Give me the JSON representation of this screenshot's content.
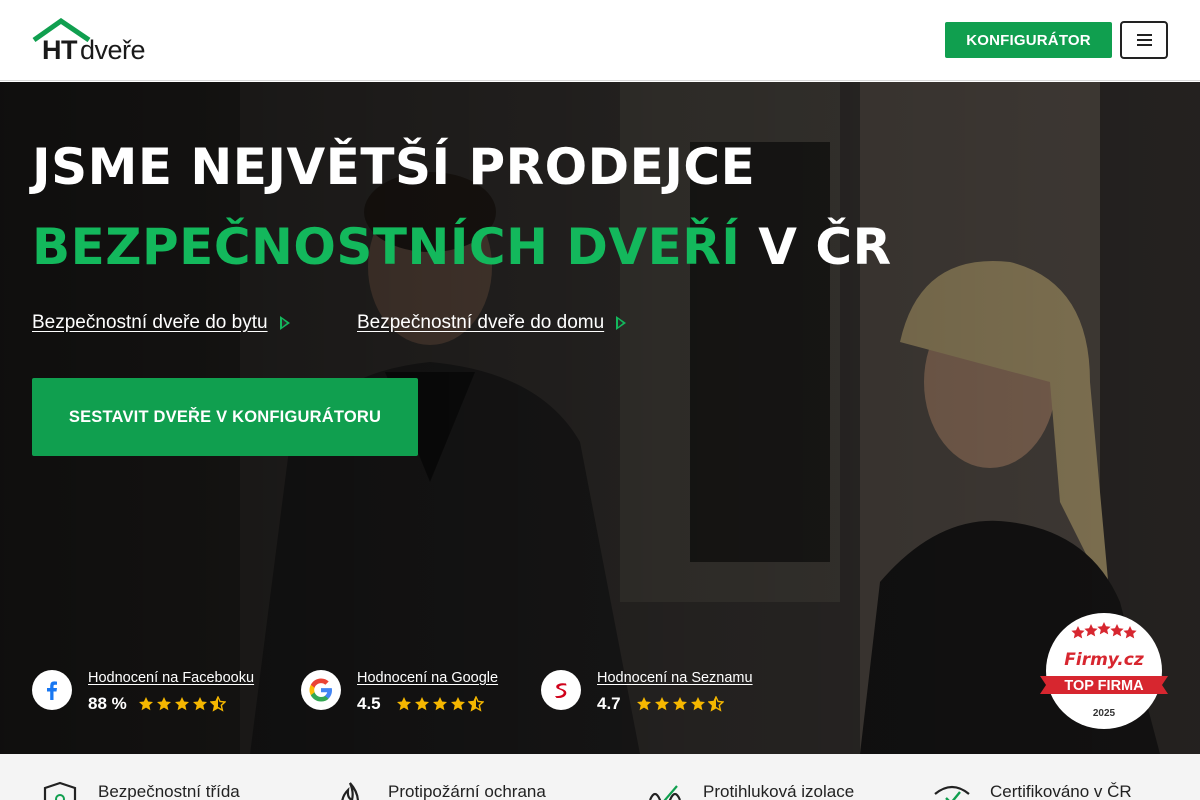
{
  "header": {
    "logo_ht": "HT",
    "logo_rest": "dveře",
    "configurator_label": "KONFIGURÁTOR"
  },
  "hero": {
    "line1": "JSME NEJVĚTŠÍ PRODEJCE",
    "line2_green": "BEZPEČNOSTNÍCH DVEŘÍ",
    "line2_rest": "V ČR",
    "links": [
      {
        "label": "Bezpečnostní dveře do bytu"
      },
      {
        "label": "Bezpečnostní dveře do domu"
      }
    ],
    "cta_label": "SESTAVIT DVEŘE V KONFIGURÁTORU"
  },
  "ratings": [
    {
      "label": "Hodnocení na Facebooku",
      "score": "88 %",
      "stars": 4.5,
      "icon": "facebook-icon"
    },
    {
      "label": "Hodnocení na Google",
      "score": "4.5",
      "stars": 4.5,
      "icon": "google-icon"
    },
    {
      "label": "Hodnocení na Seznamu",
      "score": "4.7",
      "stars": 4.5,
      "icon": "seznam-icon"
    }
  ],
  "badge": {
    "brand": "Firmy.cz",
    "title": "TOP FIRMA",
    "year": "2025"
  },
  "features": [
    {
      "label": "Bezpečnostní třída",
      "icon": "shield-icon"
    },
    {
      "label": "Protipožární ochrana",
      "icon": "flame-icon"
    },
    {
      "label": "Protihluková izolace",
      "icon": "sound-icon"
    },
    {
      "label": "Certifikováno v ČR",
      "icon": "certificate-icon"
    }
  ],
  "colors": {
    "brand_green": "#109f4f",
    "headline_green": "#13b85c",
    "star_gold": "#f5b700",
    "badge_red": "#d7262f"
  }
}
